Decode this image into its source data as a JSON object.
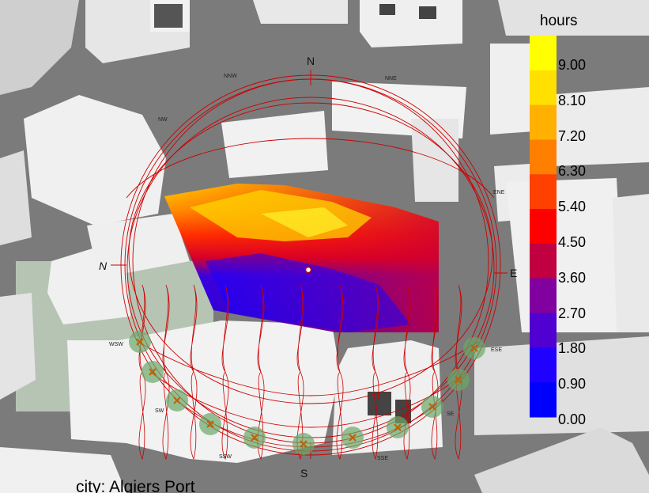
{
  "legend": {
    "title": "hours",
    "labels": [
      "9.00",
      "8.10",
      "7.20",
      "6.30",
      "5.40",
      "4.50",
      "3.60",
      "2.70",
      "1.80",
      "0.90",
      "0.00"
    ],
    "colors": [
      "#ffff00",
      "#ffe000",
      "#ffb000",
      "#ff8000",
      "#ff4000",
      "#ff0000",
      "#c00040",
      "#8000a0",
      "#5000d0",
      "#2000ff",
      "#0000ff"
    ]
  },
  "caption": "city: Algiers Port",
  "compass": {
    "N": "N",
    "S": "S",
    "E": "E",
    "W": "N",
    "NNW": "NNW",
    "NNE": "NNE",
    "NW": "NW",
    "ENE": "ENE",
    "WSW": "WSW",
    "ESE": "ESE",
    "SW": "SW",
    "SE": "SE",
    "SSW": "SSW",
    "SSE": "SSE"
  },
  "colors": {
    "ground": "#7b7b7b",
    "building": "#eeeeee",
    "sunpath": "#cc0000",
    "sun_marker": "#6aa86a"
  }
}
